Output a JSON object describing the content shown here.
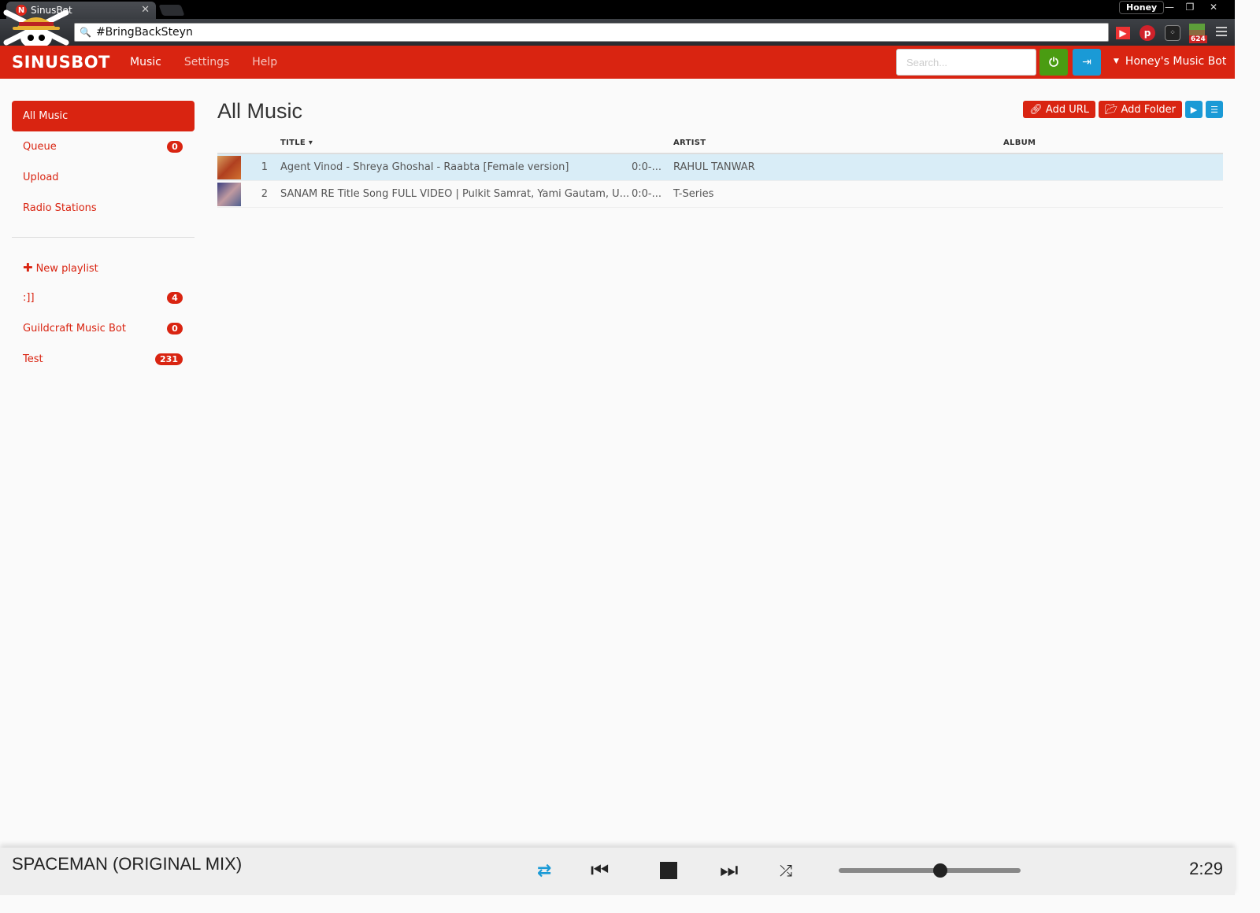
{
  "browser": {
    "tab_title": "SinusBot",
    "tab_favicon": "sinusbot-favicon",
    "omnibox_text": "#BringBackSteyn",
    "profile_name": "Honey",
    "window_controls": [
      "minimize",
      "restore",
      "close"
    ],
    "extensions": [
      {
        "name": "youtube-icon"
      },
      {
        "name": "pinterest-icon"
      },
      {
        "name": "blackberry-icon"
      },
      {
        "name": "minecraft-icon",
        "badge": "624"
      }
    ]
  },
  "navbar": {
    "brand": "SINUSBOT",
    "links": [
      {
        "label": "Music",
        "active": true
      },
      {
        "label": "Settings",
        "active": false
      },
      {
        "label": "Help",
        "active": false
      }
    ],
    "search_placeholder": "Search...",
    "bot_name": "Honey's Music Bot",
    "colors": {
      "brand": "#d92411",
      "power": "#4a9c12",
      "logout": "#1a9ad6"
    }
  },
  "sidebar": {
    "items": [
      {
        "label": "All Music",
        "active": true
      },
      {
        "label": "Queue",
        "badge": "0"
      },
      {
        "label": "Upload"
      },
      {
        "label": "Radio Stations"
      }
    ],
    "new_playlist_label": "New playlist",
    "playlists": [
      {
        "label": ":]]",
        "badge": "4"
      },
      {
        "label": "Guildcraft Music Bot",
        "badge": "0"
      },
      {
        "label": "Test",
        "badge": "231"
      }
    ]
  },
  "main": {
    "title": "All Music",
    "actions": {
      "add_url": "Add URL",
      "add_folder": "Add Folder"
    },
    "columns": {
      "title": "TITLE",
      "artist": "ARTIST",
      "album": "ALBUM"
    },
    "tracks": [
      {
        "num": "1",
        "title": "Agent Vinod - Shreya Ghoshal - Raabta [Female version]",
        "duration": "0:0-...",
        "artist": "RAHUL TANWAR",
        "album": "",
        "selected": true
      },
      {
        "num": "2",
        "title": "SANAM RE Title Song FULL VIDEO | Pulkit Samrat, Yami Gautam, U...",
        "duration": "0:0-...",
        "artist": "T-Series",
        "album": "",
        "selected": false
      }
    ]
  },
  "player": {
    "now_playing": "SPACEMAN (ORIGINAL MIX)",
    "volume_percent": 56,
    "time": "2:29",
    "repeat_active": true
  }
}
